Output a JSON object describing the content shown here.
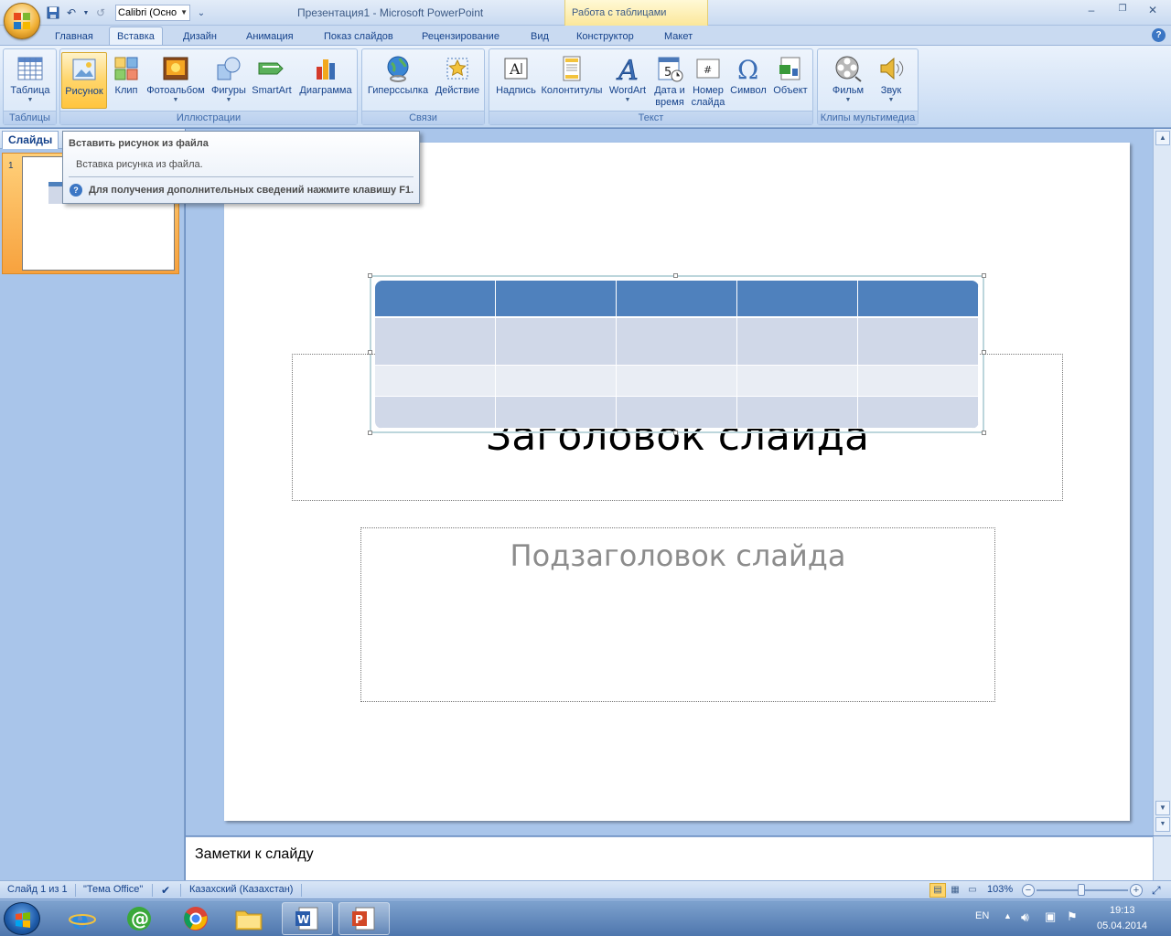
{
  "window": {
    "title": "Презентация1 - Microsoft PowerPoint",
    "contextual_group": "Работа с таблицами",
    "font_box": "Calibri (Осно"
  },
  "tabs": [
    "Главная",
    "Вставка",
    "Дизайн",
    "Анимация",
    "Показ слайдов",
    "Рецензирование",
    "Вид",
    "Конструктор",
    "Макет"
  ],
  "active_tab": "Вставка",
  "ribbon": {
    "groups": {
      "tables": "Таблицы",
      "illustrations": "Иллюстрации",
      "links": "Связи",
      "text": "Текст",
      "media": "Клипы мультимедиа"
    },
    "buttons": {
      "table": "Таблица",
      "picture": "Рисунок",
      "clip": "Клип",
      "photoalbum": "Фотоальбом",
      "shapes": "Фигуры",
      "smartart": "SmartArt",
      "chart": "Диаграмма",
      "hyperlink": "Гиперссылка",
      "action": "Действие",
      "textbox": "Надпись",
      "headerfooter": "Колонтитулы",
      "wordart": "WordArt",
      "datetime_1": "Дата и",
      "datetime_2": "время",
      "slidenum_1": "Номер",
      "slidenum_2": "слайда",
      "symbol": "Символ",
      "object": "Объект",
      "movie": "Фильм",
      "sound": "Звук"
    }
  },
  "tooltip": {
    "title": "Вставить рисунок из файла",
    "description": "Вставка рисунка из файла.",
    "help": "Для получения дополнительных сведений нажмите клавишу F1."
  },
  "left_panel": {
    "tab": "Слайды",
    "slide_number": "1"
  },
  "slide": {
    "title_placeholder": "Заголовок слайда",
    "subtitle_placeholder": "Подзаголовок слайда"
  },
  "notes": {
    "placeholder": "Заметки к слайду"
  },
  "status_bar": {
    "slide_info": "Слайд 1 из 1",
    "theme": "\"Тема Office\"",
    "language": "Казахский (Казахстан)",
    "zoom": "103%"
  },
  "taskbar": {
    "lang": "EN",
    "time": "19:13",
    "date": "05.04.2014"
  }
}
